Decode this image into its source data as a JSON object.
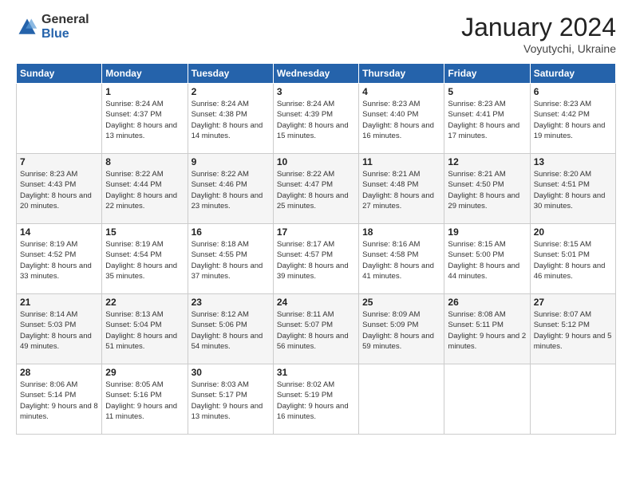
{
  "header": {
    "logo_general": "General",
    "logo_blue": "Blue",
    "month_title": "January 2024",
    "location": "Voyutychi, Ukraine"
  },
  "days_of_week": [
    "Sunday",
    "Monday",
    "Tuesday",
    "Wednesday",
    "Thursday",
    "Friday",
    "Saturday"
  ],
  "weeks": [
    [
      {
        "day": "",
        "sunrise": "",
        "sunset": "",
        "daylight": ""
      },
      {
        "day": "1",
        "sunrise": "Sunrise: 8:24 AM",
        "sunset": "Sunset: 4:37 PM",
        "daylight": "Daylight: 8 hours and 13 minutes."
      },
      {
        "day": "2",
        "sunrise": "Sunrise: 8:24 AM",
        "sunset": "Sunset: 4:38 PM",
        "daylight": "Daylight: 8 hours and 14 minutes."
      },
      {
        "day": "3",
        "sunrise": "Sunrise: 8:24 AM",
        "sunset": "Sunset: 4:39 PM",
        "daylight": "Daylight: 8 hours and 15 minutes."
      },
      {
        "day": "4",
        "sunrise": "Sunrise: 8:23 AM",
        "sunset": "Sunset: 4:40 PM",
        "daylight": "Daylight: 8 hours and 16 minutes."
      },
      {
        "day": "5",
        "sunrise": "Sunrise: 8:23 AM",
        "sunset": "Sunset: 4:41 PM",
        "daylight": "Daylight: 8 hours and 17 minutes."
      },
      {
        "day": "6",
        "sunrise": "Sunrise: 8:23 AM",
        "sunset": "Sunset: 4:42 PM",
        "daylight": "Daylight: 8 hours and 19 minutes."
      }
    ],
    [
      {
        "day": "7",
        "sunrise": "Sunrise: 8:23 AM",
        "sunset": "Sunset: 4:43 PM",
        "daylight": "Daylight: 8 hours and 20 minutes."
      },
      {
        "day": "8",
        "sunrise": "Sunrise: 8:22 AM",
        "sunset": "Sunset: 4:44 PM",
        "daylight": "Daylight: 8 hours and 22 minutes."
      },
      {
        "day": "9",
        "sunrise": "Sunrise: 8:22 AM",
        "sunset": "Sunset: 4:46 PM",
        "daylight": "Daylight: 8 hours and 23 minutes."
      },
      {
        "day": "10",
        "sunrise": "Sunrise: 8:22 AM",
        "sunset": "Sunset: 4:47 PM",
        "daylight": "Daylight: 8 hours and 25 minutes."
      },
      {
        "day": "11",
        "sunrise": "Sunrise: 8:21 AM",
        "sunset": "Sunset: 4:48 PM",
        "daylight": "Daylight: 8 hours and 27 minutes."
      },
      {
        "day": "12",
        "sunrise": "Sunrise: 8:21 AM",
        "sunset": "Sunset: 4:50 PM",
        "daylight": "Daylight: 8 hours and 29 minutes."
      },
      {
        "day": "13",
        "sunrise": "Sunrise: 8:20 AM",
        "sunset": "Sunset: 4:51 PM",
        "daylight": "Daylight: 8 hours and 30 minutes."
      }
    ],
    [
      {
        "day": "14",
        "sunrise": "Sunrise: 8:19 AM",
        "sunset": "Sunset: 4:52 PM",
        "daylight": "Daylight: 8 hours and 33 minutes."
      },
      {
        "day": "15",
        "sunrise": "Sunrise: 8:19 AM",
        "sunset": "Sunset: 4:54 PM",
        "daylight": "Daylight: 8 hours and 35 minutes."
      },
      {
        "day": "16",
        "sunrise": "Sunrise: 8:18 AM",
        "sunset": "Sunset: 4:55 PM",
        "daylight": "Daylight: 8 hours and 37 minutes."
      },
      {
        "day": "17",
        "sunrise": "Sunrise: 8:17 AM",
        "sunset": "Sunset: 4:57 PM",
        "daylight": "Daylight: 8 hours and 39 minutes."
      },
      {
        "day": "18",
        "sunrise": "Sunrise: 8:16 AM",
        "sunset": "Sunset: 4:58 PM",
        "daylight": "Daylight: 8 hours and 41 minutes."
      },
      {
        "day": "19",
        "sunrise": "Sunrise: 8:15 AM",
        "sunset": "Sunset: 5:00 PM",
        "daylight": "Daylight: 8 hours and 44 minutes."
      },
      {
        "day": "20",
        "sunrise": "Sunrise: 8:15 AM",
        "sunset": "Sunset: 5:01 PM",
        "daylight": "Daylight: 8 hours and 46 minutes."
      }
    ],
    [
      {
        "day": "21",
        "sunrise": "Sunrise: 8:14 AM",
        "sunset": "Sunset: 5:03 PM",
        "daylight": "Daylight: 8 hours and 49 minutes."
      },
      {
        "day": "22",
        "sunrise": "Sunrise: 8:13 AM",
        "sunset": "Sunset: 5:04 PM",
        "daylight": "Daylight: 8 hours and 51 minutes."
      },
      {
        "day": "23",
        "sunrise": "Sunrise: 8:12 AM",
        "sunset": "Sunset: 5:06 PM",
        "daylight": "Daylight: 8 hours and 54 minutes."
      },
      {
        "day": "24",
        "sunrise": "Sunrise: 8:11 AM",
        "sunset": "Sunset: 5:07 PM",
        "daylight": "Daylight: 8 hours and 56 minutes."
      },
      {
        "day": "25",
        "sunrise": "Sunrise: 8:09 AM",
        "sunset": "Sunset: 5:09 PM",
        "daylight": "Daylight: 8 hours and 59 minutes."
      },
      {
        "day": "26",
        "sunrise": "Sunrise: 8:08 AM",
        "sunset": "Sunset: 5:11 PM",
        "daylight": "Daylight: 9 hours and 2 minutes."
      },
      {
        "day": "27",
        "sunrise": "Sunrise: 8:07 AM",
        "sunset": "Sunset: 5:12 PM",
        "daylight": "Daylight: 9 hours and 5 minutes."
      }
    ],
    [
      {
        "day": "28",
        "sunrise": "Sunrise: 8:06 AM",
        "sunset": "Sunset: 5:14 PM",
        "daylight": "Daylight: 9 hours and 8 minutes."
      },
      {
        "day": "29",
        "sunrise": "Sunrise: 8:05 AM",
        "sunset": "Sunset: 5:16 PM",
        "daylight": "Daylight: 9 hours and 11 minutes."
      },
      {
        "day": "30",
        "sunrise": "Sunrise: 8:03 AM",
        "sunset": "Sunset: 5:17 PM",
        "daylight": "Daylight: 9 hours and 13 minutes."
      },
      {
        "day": "31",
        "sunrise": "Sunrise: 8:02 AM",
        "sunset": "Sunset: 5:19 PM",
        "daylight": "Daylight: 9 hours and 16 minutes."
      },
      {
        "day": "",
        "sunrise": "",
        "sunset": "",
        "daylight": ""
      },
      {
        "day": "",
        "sunrise": "",
        "sunset": "",
        "daylight": ""
      },
      {
        "day": "",
        "sunrise": "",
        "sunset": "",
        "daylight": ""
      }
    ]
  ]
}
